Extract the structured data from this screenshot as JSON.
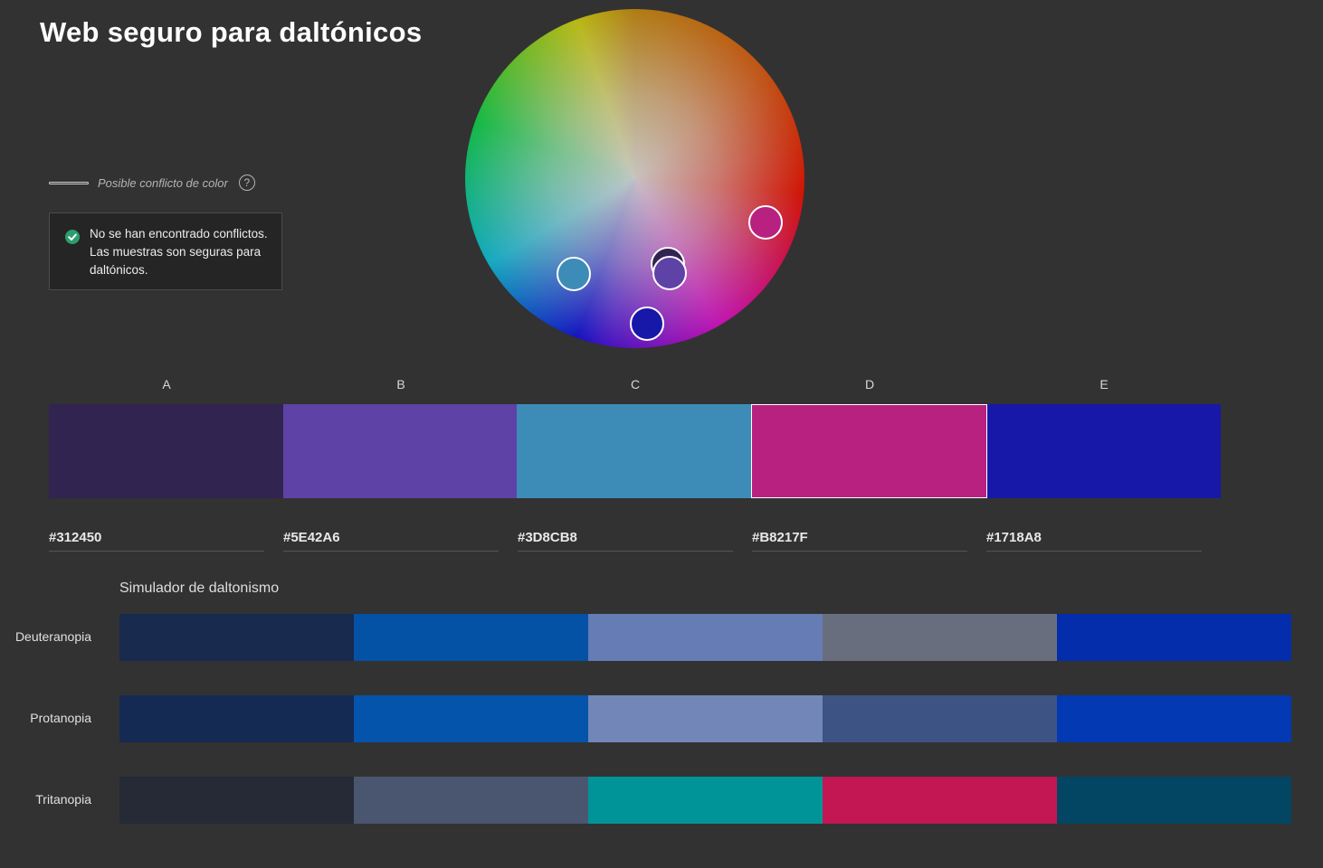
{
  "title": "Web seguro para daltónicos",
  "legend": {
    "text": "Posible conflicto de color",
    "help_icon": "?"
  },
  "status": {
    "message": "No se han encontrado conflictos. Las muestras son seguras para daltónicos.",
    "icon": "check-circle-icon",
    "icon_color": "#2D9D6D"
  },
  "swatches": [
    {
      "label": "A",
      "hex": "#312450",
      "selected": false
    },
    {
      "label": "B",
      "hex": "#5E42A6",
      "selected": false
    },
    {
      "label": "C",
      "hex": "#3D8CB8",
      "selected": false
    },
    {
      "label": "D",
      "hex": "#B8217F",
      "selected": true
    },
    {
      "label": "E",
      "hex": "#1718A8",
      "selected": false
    }
  ],
  "simulator": {
    "title": "Simulador de daltonismo",
    "rows": [
      {
        "name": "Deuteranopia",
        "colors": [
          "#192A4F",
          "#0452A6",
          "#657CB5",
          "#686E7E",
          "#032DAA"
        ]
      },
      {
        "name": "Protanopia",
        "colors": [
          "#152A52",
          "#0354AA",
          "#7386B8",
          "#3D5383",
          "#0339B2"
        ]
      },
      {
        "name": "Tritanopia",
        "colors": [
          "#252A36",
          "#4A5670",
          "#009499",
          "#C21753",
          "#024664"
        ]
      }
    ]
  }
}
